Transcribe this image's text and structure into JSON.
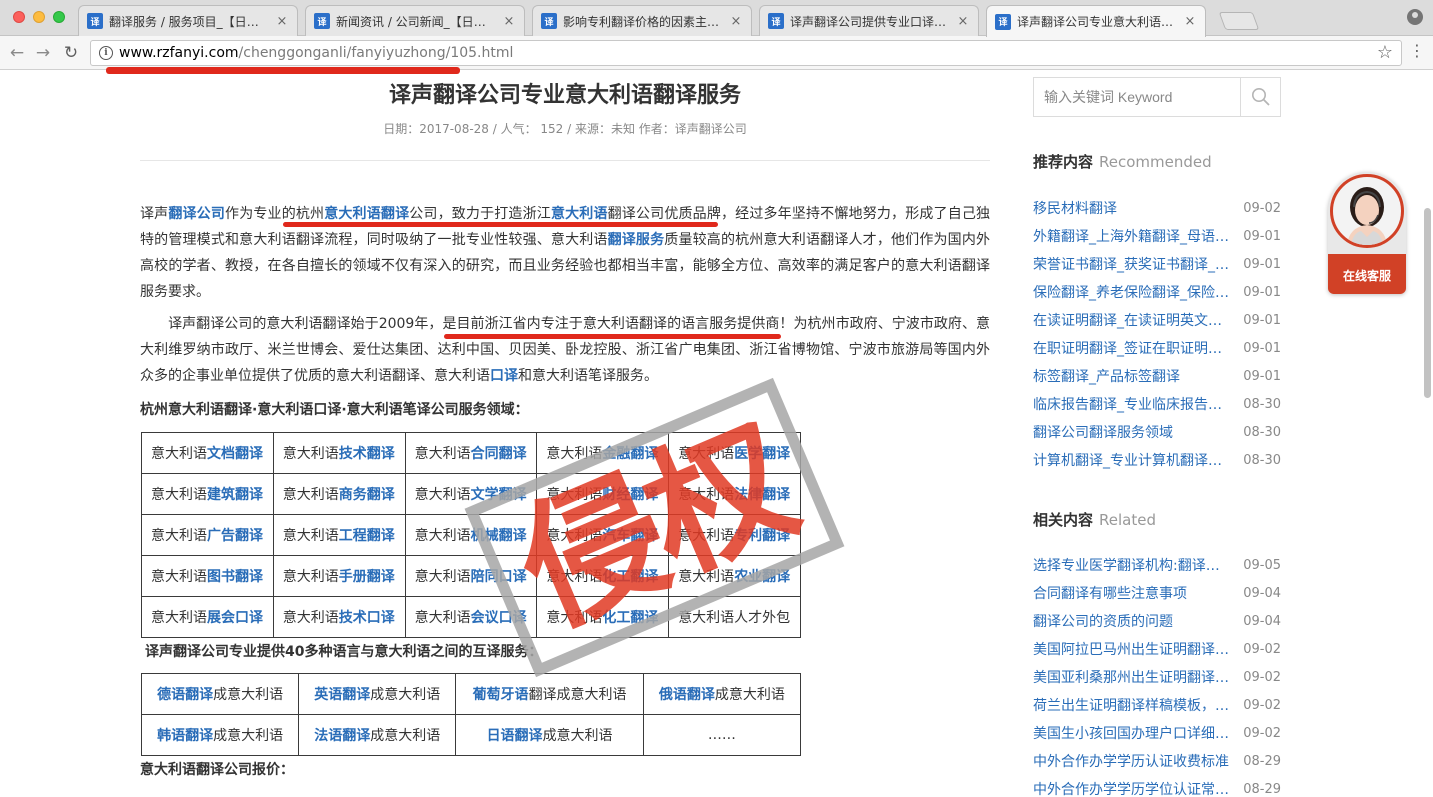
{
  "browser": {
    "tabs": [
      {
        "title": "翻译服务 / 服务项目_【日照翻译",
        "close": "×"
      },
      {
        "title": "新闻资讯 / 公司新闻_【日照翻译",
        "close": "×"
      },
      {
        "title": "影响专利翻译价格的因素主要有",
        "close": "×"
      },
      {
        "title": "译声翻译公司提供专业口译翻译",
        "close": "×"
      },
      {
        "title": "译声翻译公司专业意大利语翻译",
        "close": "×"
      }
    ],
    "url_host": "www.rzfanyi.com",
    "url_path": "/chenggonganli/fanyiyuzhong/105.html",
    "info_glyph": "i",
    "back_glyph": "←",
    "forward_glyph": "→",
    "reload_glyph": "↻",
    "star_glyph": "☆",
    "menu_glyph": "⋮",
    "annotation_color": "#e0291c"
  },
  "article": {
    "title": "译声翻译公司专业意大利语翻译服务",
    "meta": "日期：2017-08-28 / 人气：  152 / 来源：未知 作者：译声翻译公司",
    "p1": [
      {
        "t": "译声"
      },
      {
        "t": "翻译公司",
        "hl": true
      },
      {
        "t": "作为专业的杭州"
      },
      {
        "t": "意大利语翻译",
        "hl": true
      },
      {
        "t": "公司，致力于打造浙江"
      },
      {
        "t": "意大利语",
        "hl": true
      },
      {
        "t": "翻译公司优质品牌，经过多年坚持不懈地努力，形成了自己独特的管理模式和意大利语翻译流程，同时吸纳了一批专业性较强、意大利语"
      },
      {
        "t": "翻译服务",
        "hl": true
      },
      {
        "t": "质量较高的杭州意大利语翻译人才，他们作为国内外高校的学者、教授，在各自擅长的领域不仅有深入的研究，而且业务经验也都相当丰富，能够全方位、高效率的满足客户的意大利语翻译服务要求。"
      }
    ],
    "p2": [
      {
        "t": "　　译声翻译公司的意大利语翻译始于2009年，是目前浙江省内专注于意大利语翻译的语言服务提供商！为杭州市政府、宁波市政府、意大利维罗纳市政厅、米兰世博会、爱仕达集团、达利中国、贝因美、卧龙控股、浙江省广电集团、浙江省博物馆、宁波市旅游局等国内外众多的企事业单位提供了优质的意大利语翻译、意大利语"
      },
      {
        "t": "口译",
        "hl": true
      },
      {
        "t": "和意大利语笔译服务。"
      }
    ],
    "service_heading": "杭州意大利语翻译·意大利语口译·意大利语笔译公司服务领域：",
    "service_table": [
      [
        {
          "p": "意大利语",
          "h": "文档翻译"
        },
        {
          "p": "意大利语",
          "h": "技术翻译"
        },
        {
          "p": "意大利语",
          "h": "合同翻译"
        },
        {
          "p": "意大利语",
          "h": "金融翻译"
        },
        {
          "p": "意大利语",
          "h": "医学翻译"
        }
      ],
      [
        {
          "p": "意大利语",
          "h": "建筑翻译"
        },
        {
          "p": "意大利语",
          "h": "商务翻译"
        },
        {
          "p": "意大利语",
          "h": "文学翻译"
        },
        {
          "p": "意大利语",
          "h": "财经翻译"
        },
        {
          "p": "意大利语",
          "h": "法律翻译"
        }
      ],
      [
        {
          "p": "意大利语",
          "h": "广告翻译"
        },
        {
          "p": "意大利语",
          "h": "工程翻译"
        },
        {
          "p": "意大利语",
          "h": "机械翻译"
        },
        {
          "p": "意大利语",
          "h": "汽车翻译"
        },
        {
          "p": "意大利语",
          "h": "专利翻译"
        }
      ],
      [
        {
          "p": "意大利语",
          "h": "图书翻译"
        },
        {
          "p": "意大利语",
          "h": "手册翻译"
        },
        {
          "p": "意大利语",
          "h": "陪同口译"
        },
        {
          "p": "意大利语",
          "h": "化工翻译"
        },
        {
          "p": "意大利语",
          "h": "农业翻译"
        }
      ],
      [
        {
          "p": "意大利语",
          "h": "展会口译"
        },
        {
          "p": "意大利语",
          "h": "技术口译"
        },
        {
          "p": "意大利语",
          "h": "会议口译"
        },
        {
          "p": "意大利语",
          "h": "化工翻译"
        },
        {
          "p": "意大利语人才外包",
          "h": ""
        }
      ]
    ],
    "lang_heading": "译声翻译公司专业提供40多种语言与意大利语之间的互译服务：",
    "lang_table": [
      [
        {
          "h": "德语翻译",
          "s": "成意大利语"
        },
        {
          "h": "英语翻译",
          "s": "成意大利语"
        },
        {
          "h": "葡萄牙语",
          "s": "翻译成意大利语"
        },
        {
          "h": "俄语翻译",
          "s": "成意大利语"
        }
      ],
      [
        {
          "h": "韩语翻译",
          "s": "成意大利语"
        },
        {
          "h": "法语翻译",
          "s": "成意大利语"
        },
        {
          "h": "日语翻译",
          "s": "成意大利语"
        },
        {
          "h": "",
          "s": "……"
        }
      ]
    ],
    "price_heading": "意大利语翻译公司报价："
  },
  "watermark": {
    "text": "侵权",
    "color": "#e13a24"
  },
  "sidebar": {
    "search_placeholder": "输入关键词 Keyword",
    "recommended_cn": "推荐内容",
    "recommended_en": "Recommended",
    "recommended": [
      {
        "title": "移民材料翻译",
        "date": "09-02"
      },
      {
        "title": "外籍翻译_上海外籍翻译_母语翻译",
        "date": "09-01"
      },
      {
        "title": "荣誉证书翻译_获奖证书翻译_证书翻译",
        "date": "09-01"
      },
      {
        "title": "保险翻译_养老保险翻译_保险单翻译",
        "date": "09-01"
      },
      {
        "title": "在读证明翻译_在读证明英文翻译",
        "date": "09-01"
      },
      {
        "title": "在职证明翻译_签证在职证明翻译",
        "date": "09-01"
      },
      {
        "title": "标签翻译_产品标签翻译",
        "date": "09-01"
      },
      {
        "title": "临床报告翻译_专业临床报告翻译",
        "date": "08-30"
      },
      {
        "title": "翻译公司翻译服务领域",
        "date": "08-30"
      },
      {
        "title": "计算机翻译_专业计算机翻译服务",
        "date": "08-30"
      }
    ],
    "related_cn": "相关内容",
    "related_en": "Related",
    "related": [
      {
        "title": "选择专业医学翻译机构:翻译质量",
        "date": "09-05"
      },
      {
        "title": "合同翻译有哪些注意事项",
        "date": "09-04"
      },
      {
        "title": "翻译公司的资质的问题",
        "date": "09-04"
      },
      {
        "title": "美国阿拉巴马州出生证明翻译模板",
        "date": "09-02"
      },
      {
        "title": "美国亚利桑那州出生证明翻译模板",
        "date": "09-02"
      },
      {
        "title": "荷兰出生证明翻译样稿模板，翻译",
        "date": "09-02"
      },
      {
        "title": "美国生小孩回国办理户口详细流程",
        "date": "09-02"
      },
      {
        "title": "中外合作办学学历认证收费标准",
        "date": "08-29"
      },
      {
        "title": "中外合作办学学历学位认证常见问题",
        "date": "08-29"
      }
    ]
  },
  "customer_service": {
    "label": "在线客服"
  }
}
